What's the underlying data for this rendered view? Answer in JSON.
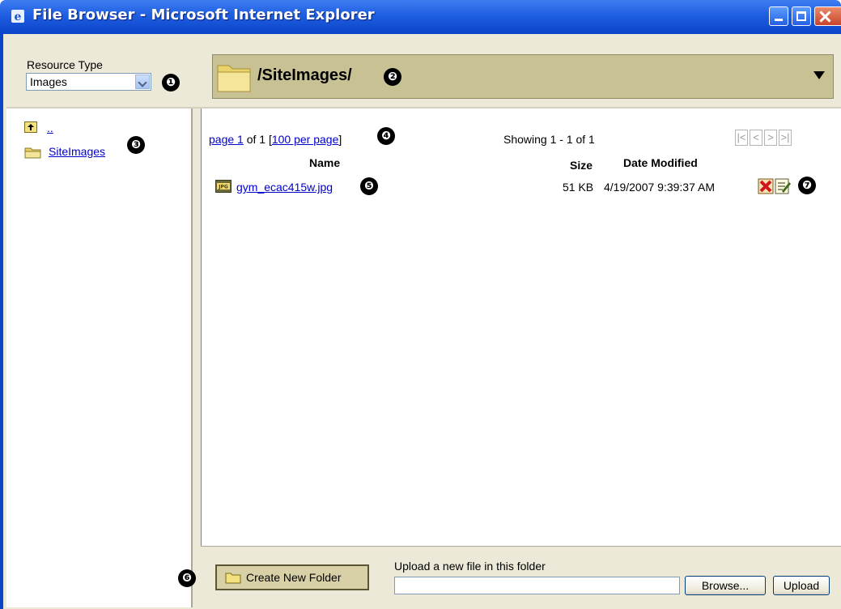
{
  "window": {
    "title": "File Browser - Microsoft Internet Explorer"
  },
  "resource_type": {
    "label": "Resource Type",
    "value": "Images"
  },
  "path_bar": {
    "path": "/SiteImages/"
  },
  "tree": {
    "up_label": "..",
    "folder_label": "SiteImages"
  },
  "paging": {
    "page_link": "page 1",
    "of_text": " of 1 [",
    "per_page_link": "100 per page",
    "close_bracket": "]",
    "showing": "Showing 1 - 1 of 1",
    "first": "|<",
    "prev": "<",
    "next": ">",
    "last": ">|"
  },
  "table": {
    "headers": {
      "name": "Name",
      "size": "Size",
      "date": "Date Modified"
    },
    "rows": [
      {
        "name": "gym_ecac415w.jpg",
        "size": "51 KB",
        "date": "4/19/2007 9:39:37 AM",
        "type_badge": "JPG"
      }
    ]
  },
  "bottom": {
    "create_folder": "Create New Folder",
    "upload_label": "Upload a new file in this folder",
    "browse": "Browse...",
    "upload": "Upload"
  },
  "callouts": [
    "❶",
    "❷",
    "❸",
    "❹",
    "❺",
    "❻",
    "❼"
  ],
  "colors": {
    "titlebar": "#1f5ee0",
    "path_bar": "#c8c193",
    "link": "#0000cc",
    "frame": "#ece9d8"
  }
}
